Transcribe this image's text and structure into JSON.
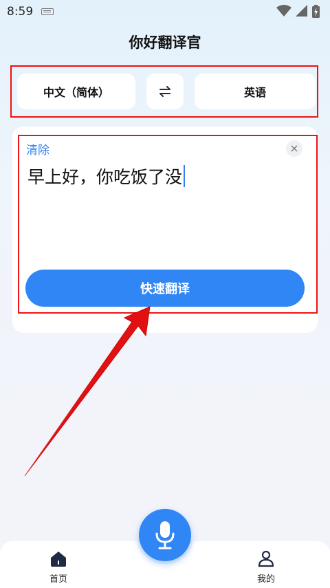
{
  "status_bar": {
    "time": "8:59"
  },
  "app": {
    "title": "你好翻译官"
  },
  "language_bar": {
    "source": "中文（简体）",
    "target": "英语"
  },
  "input": {
    "clear_label": "清除",
    "close_glyph": "×",
    "text": "早上好，你吃饭了没"
  },
  "translate_button": {
    "label": "快速翻译"
  },
  "bottom_nav": {
    "items": [
      {
        "label": "首页",
        "icon": "home-icon",
        "active": true
      },
      {
        "label": "我的",
        "icon": "user-icon",
        "active": false
      }
    ],
    "center_icon": "microphone-icon"
  },
  "colors": {
    "accent": "#2f86f4",
    "highlight_box": "#e11111",
    "text": "#111111"
  }
}
